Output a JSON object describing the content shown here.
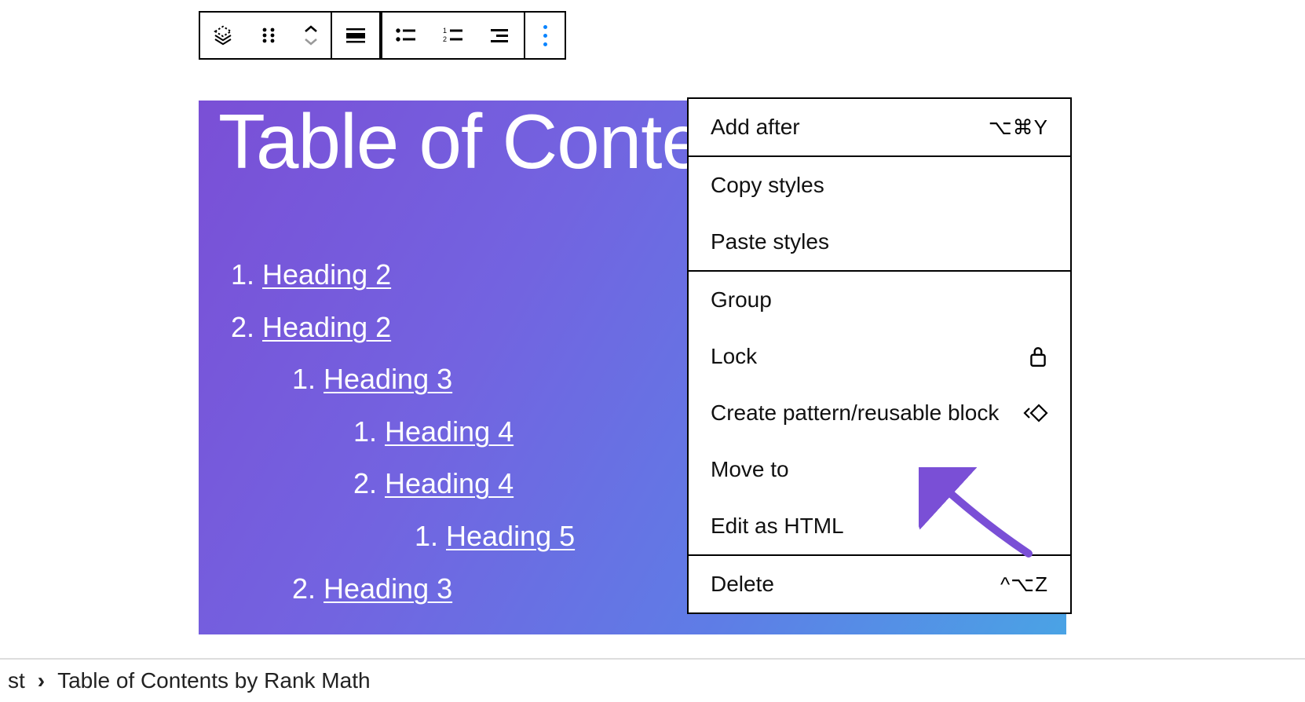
{
  "toolbar": {
    "icons": {
      "block_type": "block-type-icon",
      "drag": "drag-handle-icon",
      "move_up": "chevron-up-icon",
      "move_down": "chevron-down-icon",
      "align": "align-icon",
      "bullet": "bullet-list-icon",
      "numbered": "numbered-list-icon",
      "outline": "outline-list-icon",
      "more": "more-options-icon"
    }
  },
  "toc": {
    "title": "Table of Contents",
    "items": [
      {
        "label": "Heading 2",
        "children": []
      },
      {
        "label": "Heading 2",
        "children": [
          {
            "label": "Heading 3",
            "children": [
              {
                "label": "Heading 4",
                "children": []
              },
              {
                "label": "Heading 4",
                "children": [
                  {
                    "label": "Heading 5",
                    "children": []
                  }
                ]
              }
            ]
          },
          {
            "label": "Heading 3",
            "children": []
          }
        ]
      }
    ]
  },
  "context_menu": {
    "items": [
      {
        "label": "Add after",
        "shortcut": "⌥⌘Y",
        "icon": null,
        "sep_after": true
      },
      {
        "label": "Copy styles",
        "shortcut": "",
        "icon": null
      },
      {
        "label": "Paste styles",
        "shortcut": "",
        "icon": null,
        "sep_after": true
      },
      {
        "label": "Group",
        "shortcut": "",
        "icon": null
      },
      {
        "label": "Lock",
        "shortcut": "",
        "icon": "lock-icon"
      },
      {
        "label": "Create pattern/reusable block",
        "shortcut": "",
        "icon": "pattern-icon"
      },
      {
        "label": "Move to",
        "shortcut": "",
        "icon": null
      },
      {
        "label": "Edit as HTML",
        "shortcut": "",
        "icon": null,
        "sep_after": true
      },
      {
        "label": "Delete",
        "shortcut": "^⌥Z",
        "icon": null
      }
    ]
  },
  "breadcrumb": {
    "prefix": "st",
    "current": "Table of Contents by Rank Math"
  },
  "colors": {
    "accent_arrow": "#7a4fd6"
  }
}
